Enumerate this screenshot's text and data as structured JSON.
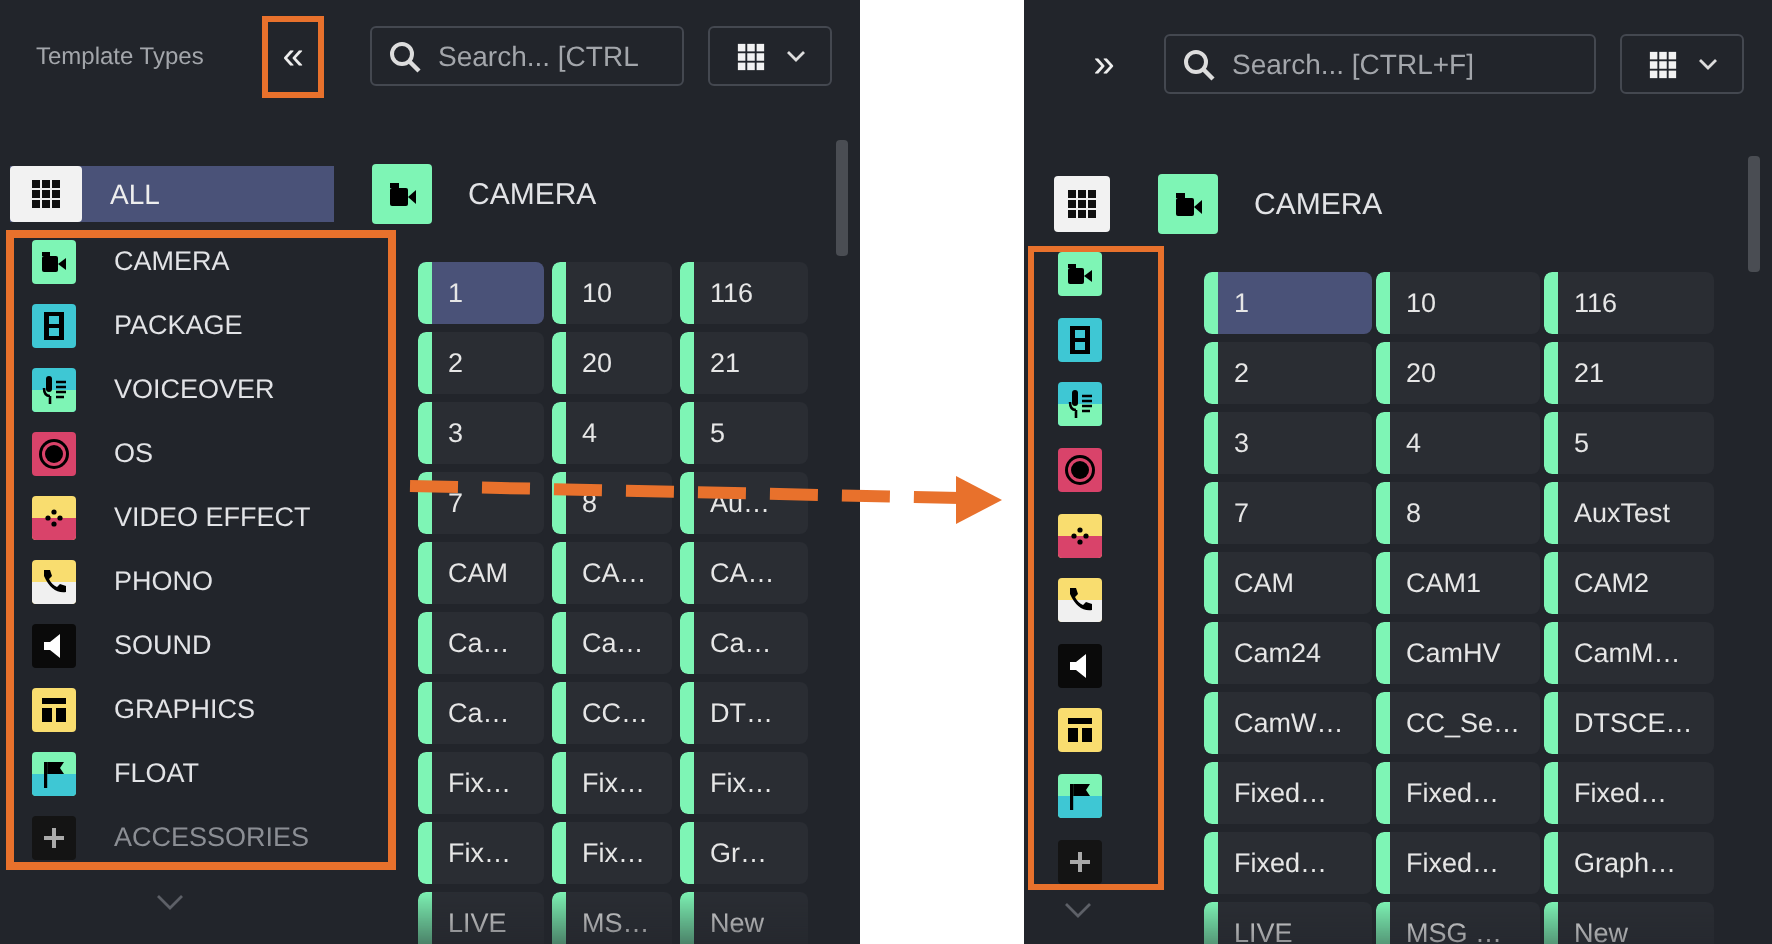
{
  "expanded_panel": {
    "title": "Template Types",
    "collapse_button": "«",
    "search": {
      "placeholder": "Search... [CTRL"
    },
    "all_item": {
      "label": "ALL",
      "selected": true
    },
    "categories": [
      {
        "label": "CAMERA",
        "color": "#7ef5b5",
        "disabled": false
      },
      {
        "label": "PACKAGE",
        "color": "#3ec7d4",
        "disabled": false
      },
      {
        "label": "VOICEOVER",
        "color": "#3ec7d4",
        "disabled": false
      },
      {
        "label": "OS",
        "color": "#d9436a",
        "disabled": false
      },
      {
        "label": "VIDEO EFFECT",
        "color": "#f9dd6f",
        "disabled": false
      },
      {
        "label": "PHONO",
        "color": "#f9dd6f",
        "disabled": false
      },
      {
        "label": "SOUND",
        "color": "#0a0a0a",
        "disabled": false
      },
      {
        "label": "GRAPHICS",
        "color": "#f9dd6f",
        "disabled": false
      },
      {
        "label": "FLOAT",
        "color": "#7ef5b5",
        "disabled": false
      },
      {
        "label": "ACCESSORIES",
        "color": "#141414",
        "disabled": true
      }
    ],
    "section_title": "CAMERA",
    "templates": [
      {
        "label": "1",
        "selected": true
      },
      {
        "label": "10",
        "selected": false
      },
      {
        "label": "116",
        "selected": false
      },
      {
        "label": "2",
        "selected": false
      },
      {
        "label": "20",
        "selected": false
      },
      {
        "label": "21",
        "selected": false
      },
      {
        "label": "3",
        "selected": false
      },
      {
        "label": "4",
        "selected": false
      },
      {
        "label": "5",
        "selected": false
      },
      {
        "label": "7",
        "selected": false
      },
      {
        "label": "8",
        "selected": false
      },
      {
        "label": "Au…",
        "selected": false
      },
      {
        "label": "CAM",
        "selected": false
      },
      {
        "label": "CA…",
        "selected": false
      },
      {
        "label": "CA…",
        "selected": false
      },
      {
        "label": "Ca…",
        "selected": false
      },
      {
        "label": "Ca…",
        "selected": false
      },
      {
        "label": "Ca…",
        "selected": false
      },
      {
        "label": "Ca…",
        "selected": false
      },
      {
        "label": "CC…",
        "selected": false
      },
      {
        "label": "DT…",
        "selected": false
      },
      {
        "label": "Fix…",
        "selected": false
      },
      {
        "label": "Fix…",
        "selected": false
      },
      {
        "label": "Fix…",
        "selected": false
      },
      {
        "label": "Fix…",
        "selected": false
      },
      {
        "label": "Fix…",
        "selected": false
      },
      {
        "label": "Gr…",
        "selected": false
      },
      {
        "label": "LIVE",
        "selected": false
      },
      {
        "label": "MS…",
        "selected": false
      },
      {
        "label": "New",
        "selected": false
      }
    ]
  },
  "collapsed_panel": {
    "expand_button": "»",
    "search": {
      "placeholder": "Search... [CTRL+F]"
    },
    "categories": [
      {
        "color": "#7ef5b5",
        "disabled": false
      },
      {
        "color": "#3ec7d4",
        "disabled": false
      },
      {
        "color": "#3ec7d4",
        "disabled": false
      },
      {
        "color": "#d9436a",
        "disabled": false
      },
      {
        "color": "#f9dd6f",
        "disabled": false
      },
      {
        "color": "#f9dd6f",
        "disabled": false
      },
      {
        "color": "#0a0a0a",
        "disabled": false
      },
      {
        "color": "#f9dd6f",
        "disabled": false
      },
      {
        "color": "#7ef5b5",
        "disabled": false
      },
      {
        "color": "#141414",
        "disabled": true
      }
    ],
    "section_title": "CAMERA",
    "templates": [
      {
        "label": "1",
        "selected": true
      },
      {
        "label": "10",
        "selected": false
      },
      {
        "label": "116",
        "selected": false
      },
      {
        "label": "2",
        "selected": false
      },
      {
        "label": "20",
        "selected": false
      },
      {
        "label": "21",
        "selected": false
      },
      {
        "label": "3",
        "selected": false
      },
      {
        "label": "4",
        "selected": false
      },
      {
        "label": "5",
        "selected": false
      },
      {
        "label": "7",
        "selected": false
      },
      {
        "label": "8",
        "selected": false
      },
      {
        "label": "AuxTest",
        "selected": false
      },
      {
        "label": "CAM",
        "selected": false
      },
      {
        "label": "CAM1",
        "selected": false
      },
      {
        "label": "CAM2",
        "selected": false
      },
      {
        "label": "Cam24",
        "selected": false
      },
      {
        "label": "CamHV",
        "selected": false
      },
      {
        "label": "CamM…",
        "selected": false
      },
      {
        "label": "CamW…",
        "selected": false
      },
      {
        "label": "CC_Se…",
        "selected": false
      },
      {
        "label": "DTSCE…",
        "selected": false
      },
      {
        "label": "Fixed…",
        "selected": false
      },
      {
        "label": "Fixed…",
        "selected": false
      },
      {
        "label": "Fixed…",
        "selected": false
      },
      {
        "label": "Fixed…",
        "selected": false
      },
      {
        "label": "Fixed…",
        "selected": false
      },
      {
        "label": "Graph…",
        "selected": false
      },
      {
        "label": "LIVE",
        "selected": false
      },
      {
        "label": "MSG …",
        "selected": false
      },
      {
        "label": "New",
        "selected": false
      }
    ]
  }
}
